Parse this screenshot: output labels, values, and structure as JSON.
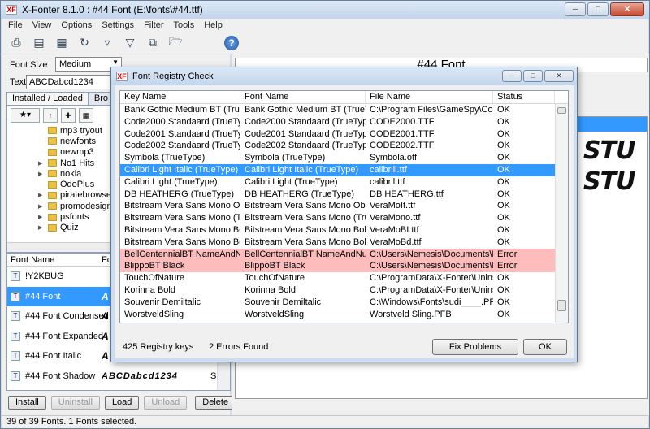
{
  "app": {
    "title": "X-Fonter 8.1.0  :  #44 Font (E:\\fonts\\#44.ttf)",
    "icon_text": "XF"
  },
  "menu": [
    "File",
    "View",
    "Options",
    "Settings",
    "Filter",
    "Tools",
    "Help"
  ],
  "toolbar": {
    "icons": [
      "printer-icon",
      "print-list-icon",
      "calculator-icon",
      "refresh-icon",
      "filter-icon",
      "clear-filter-icon",
      "copy-fonts-icon",
      "folder-add-icon",
      "help-icon"
    ],
    "help_glyph": "?"
  },
  "options": {
    "font_size_label": "Font Size",
    "font_size_value": "Medium",
    "text_label": "Text",
    "text_value": "ABCDabcd1234"
  },
  "tabs": {
    "installed": "Installed / Loaded",
    "browse": "Bro"
  },
  "tree": {
    "items": [
      "mp3 tryout",
      "newfonts",
      "newmp3",
      "No1 Hits",
      "nokia",
      "OdoPlus",
      "piratebrowser",
      "promodesign",
      "psfonts",
      "Quiz"
    ]
  },
  "font_list": {
    "col_name": "Font Name",
    "col_preview": "Fo",
    "rows": [
      {
        "name": "!Y2KBUG",
        "preview": "",
        "selected": false
      },
      {
        "name": "#44 Font",
        "preview": "A",
        "selected": true
      },
      {
        "name": "#44 Font Condensed",
        "preview": "A",
        "selected": false
      },
      {
        "name": "#44 Font Expanded",
        "preview": "A",
        "selected": false
      },
      {
        "name": "#44 Font Italic",
        "preview": "A",
        "selected": false
      },
      {
        "name": "#44 Font Shadow",
        "preview": "ABCDabcd1234",
        "selected": false
      }
    ],
    "preview_tail": "S"
  },
  "left_buttons": {
    "install": "Install",
    "uninstall": "Uninstall",
    "load": "Load",
    "unload": "Unload",
    "delete": "Delete"
  },
  "status": "39 of 39 Fonts.  1 Fonts selected.",
  "preview": {
    "title": "#44 Font",
    "sample_line1": "STU",
    "sample_line2": "STU"
  },
  "dialog": {
    "title": "Font Registry Check",
    "columns": [
      "Key Name",
      "Font Name",
      "File Name",
      "Status"
    ],
    "rows": [
      {
        "key": "Bank Gothic Medium BT (TrueType)",
        "font": "Bank Gothic Medium BT (TrueType)",
        "file": "C:\\Program Files\\GameSpy\\Comrad...",
        "status": "OK",
        "state": "normal"
      },
      {
        "key": "Code2000 Standaard (TrueType)",
        "font": "Code2000 Standaard (TrueType)",
        "file": "CODE2000.TTF",
        "status": "OK",
        "state": "normal"
      },
      {
        "key": "Code2001 Standaard (TrueType)",
        "font": "Code2001 Standaard (TrueType)",
        "file": "CODE2001.TTF",
        "status": "OK",
        "state": "normal"
      },
      {
        "key": "Code2002 Standaard (TrueType)",
        "font": "Code2002 Standaard (TrueType)",
        "file": "CODE2002.TTF",
        "status": "OK",
        "state": "normal"
      },
      {
        "key": "Symbola (TrueType)",
        "font": "Symbola (TrueType)",
        "file": "Symbola.otf",
        "status": "OK",
        "state": "normal"
      },
      {
        "key": "Calibri Light Italic (TrueType)",
        "font": "Calibri Light Italic (TrueType)",
        "file": "calibrili.ttf",
        "status": "OK",
        "state": "selected"
      },
      {
        "key": "Calibri Light (TrueType)",
        "font": "Calibri Light (TrueType)",
        "file": "calibril.ttf",
        "status": "OK",
        "state": "normal"
      },
      {
        "key": "DB HEATHERG (TrueType)",
        "font": "DB HEATHERG (TrueType)",
        "file": "DB HEATHERG.ttf",
        "status": "OK",
        "state": "normal"
      },
      {
        "key": "Bitstream Vera Sans Mono Obliqu...",
        "font": "Bitstream Vera Sans Mono Oblique ...",
        "file": "VeraMoIt.ttf",
        "status": "OK",
        "state": "normal"
      },
      {
        "key": "Bitstream Vera Sans Mono (TrueT...",
        "font": "Bitstream Vera Sans Mono (TrueTy...",
        "file": "VeraMono.ttf",
        "status": "OK",
        "state": "normal"
      },
      {
        "key": "Bitstream Vera Sans Mono Bold O...",
        "font": "Bitstream Vera Sans Mono Bold Obl...",
        "file": "VeraMoBI.ttf",
        "status": "OK",
        "state": "normal"
      },
      {
        "key": "Bitstream Vera Sans Mono Bold (T...",
        "font": "Bitstream Vera Sans Mono Bold (Tr...",
        "file": "VeraMoBd.ttf",
        "status": "OK",
        "state": "normal"
      },
      {
        "key": "BellCentennialBT NameAndNum...",
        "font": "BellCentennialBT NameAndNumber",
        "file": "C:\\Users\\Nemesis\\Documents\\My ...",
        "status": "Error",
        "state": "error"
      },
      {
        "key": "BlippoBT Black",
        "font": "BlippoBT Black",
        "file": "C:\\Users\\Nemesis\\Documents\\My ...",
        "status": "Error",
        "state": "error"
      },
      {
        "key": "TouchOfNature",
        "font": "TouchOfNature",
        "file": "C:\\ProgramData\\X-Fonter\\Uninstall...",
        "status": "OK",
        "state": "normal"
      },
      {
        "key": "Korinna Bold",
        "font": "Korinna Bold",
        "file": "C:\\ProgramData\\X-Fonter\\Uninstall...",
        "status": "OK",
        "state": "normal"
      },
      {
        "key": "Souvenir Demiltalic",
        "font": "Souvenir Demiltalic",
        "file": "C:\\Windows\\Fonts\\sudi____.PFB",
        "status": "OK",
        "state": "normal"
      },
      {
        "key": "WorstveldSling",
        "font": "WorstveldSling",
        "file": "Worstveld Sling.PFB",
        "status": "OK",
        "state": "normal"
      }
    ],
    "registry_keys": "425 Registry keys",
    "errors_found": "2 Errors Found",
    "fix_button": "Fix Problems",
    "ok_button": "OK"
  },
  "colors": {
    "selection": "#3399ff",
    "error_row": "#ffbcbc",
    "title_bar": "#c4d6ec"
  }
}
